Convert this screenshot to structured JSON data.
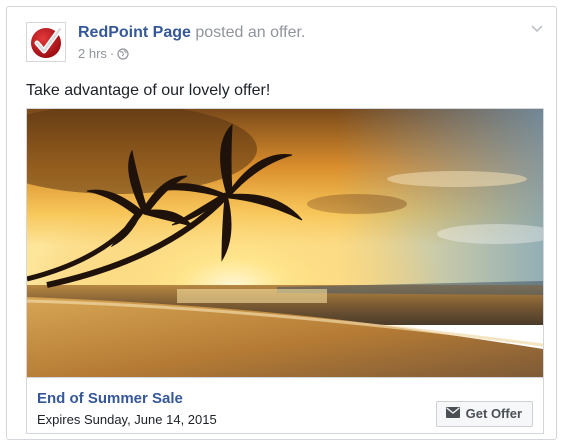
{
  "post": {
    "page_name": "RedPoint Page",
    "action_text": "posted an offer.",
    "time": "2 hrs",
    "separator": "·",
    "privacy_icon": "globe-icon",
    "menu_icon": "chevron-down-icon",
    "message": "Take advantage of our lovely offer!"
  },
  "offer": {
    "image_description_icon": "beach-sunset-image",
    "title": "End of Summer Sale",
    "expires": "Expires Sunday, June 14, 2015",
    "button_label": "Get Offer",
    "button_icon": "envelope-icon"
  },
  "colors": {
    "link_blue": "#365899",
    "meta_gray": "#90949c",
    "text_dark": "#1d2129",
    "logo_red": "#c1121f"
  }
}
